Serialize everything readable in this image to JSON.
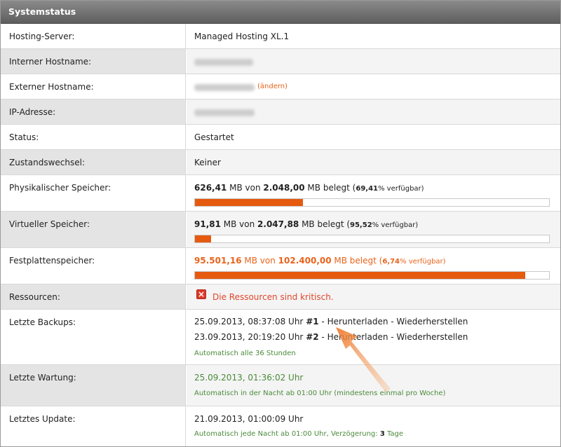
{
  "header": {
    "title": "Systemstatus"
  },
  "rows": {
    "hosting_server": {
      "label": "Hosting-Server:",
      "value": "Managed Hosting XL.1"
    },
    "intern_hostname": {
      "label": "Interner Hostname:"
    },
    "extern_hostname": {
      "label": "Externer Hostname:",
      "link": "(ändern)"
    },
    "ip": {
      "label": "IP-Adresse:"
    },
    "status": {
      "label": "Status:",
      "value": "Gestartet"
    },
    "zustand": {
      "label": "Zustandswechsel:",
      "value": "Keiner"
    },
    "phys": {
      "label": "Physikalischer Speicher:",
      "used": "626,41",
      "unit1": " MB von ",
      "total": "2.048,00",
      "unit2": " MB belegt (",
      "free": "69,41",
      "free_suffix": "% verfügbar)",
      "used_fraction": 0.3059
    },
    "virt": {
      "label": "Virtueller Speicher:",
      "used": "91,81",
      "unit1": " MB von ",
      "total": "2.047,88",
      "unit2": " MB belegt (",
      "free": "95,52",
      "free_suffix": "% verfügbar)",
      "used_fraction": 0.0448
    },
    "disk": {
      "label": "Festplattenspeicher:",
      "used": "95.501,16",
      "unit1": " MB von ",
      "total": "102.400,00",
      "unit2": " MB belegt (",
      "free": "6,74",
      "free_suffix": "% verfügbar)",
      "used_fraction": 0.9326
    },
    "ressourcen": {
      "label": "Ressourcen:",
      "value": "Die Ressourcen sind kritisch.",
      "icon": "error-x-icon"
    },
    "backups": {
      "label": "Letzte Backups:",
      "entries": [
        {
          "date": "25.09.2013, 08:37:08 Uhr ",
          "num": "#1",
          "dash1": " - ",
          "download": "Herunterladen",
          "dash2": " - ",
          "restore": "Wiederherstellen"
        },
        {
          "date": "23.09.2013, 20:19:20 Uhr ",
          "num": "#2",
          "dash1": " - ",
          "download": "Herunterladen",
          "dash2": " - ",
          "restore": "Wiederherstellen"
        }
      ],
      "note": "Automatisch alle 36 Stunden"
    },
    "wartung": {
      "label": "Letzte Wartung:",
      "value": "25.09.2013, 01:36:02 Uhr",
      "note": "Automatisch in der Nacht ab 01:00 Uhr (mindestens einmal pro Woche)"
    },
    "update": {
      "label": "Letztes Update:",
      "value": "21.09.2013, 01:00:09 Uhr",
      "note_prefix": "Automatisch jede Nacht ab 01:00 Uhr, Verzögerung: ",
      "note_days": "3",
      "note_suffix": " Tage"
    }
  },
  "colors": {
    "accent": "#e55a0f",
    "green": "#4a8a3a",
    "error": "#d93a2a"
  }
}
